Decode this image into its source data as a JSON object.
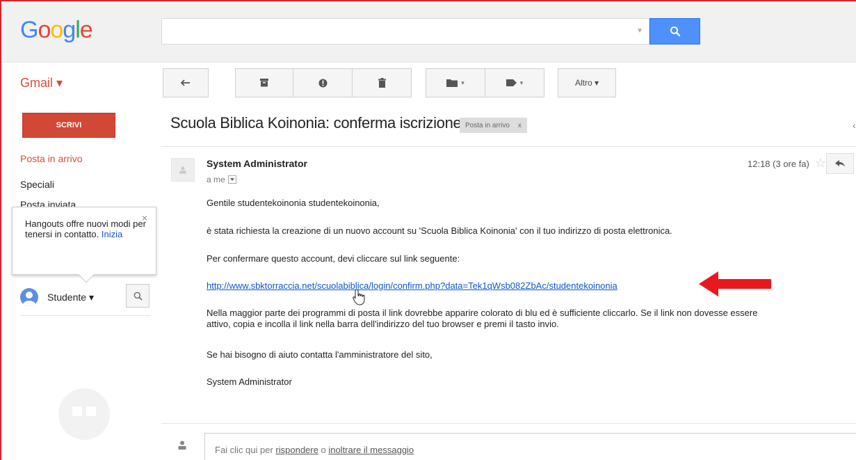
{
  "header": {
    "logo_letters": [
      {
        "ch": "G",
        "color": "#4285f4"
      },
      {
        "ch": "o",
        "color": "#ea4335"
      },
      {
        "ch": "o",
        "color": "#fbbc05"
      },
      {
        "ch": "g",
        "color": "#4285f4"
      },
      {
        "ch": "l",
        "color": "#34a853"
      },
      {
        "ch": "e",
        "color": "#ea4335"
      }
    ],
    "search_value": "",
    "search_dropdown": "▼"
  },
  "toolbar": {
    "app_label": "Gmail ▾",
    "more_label": "Altro ▾",
    "dropdown_caret": "▾"
  },
  "sidebar": {
    "compose_label": "SCRIVI",
    "items": [
      {
        "label": "Posta in arrivo"
      },
      {
        "label": "Speciali"
      },
      {
        "label": "Posta inviata"
      }
    ]
  },
  "hangouts_popup": {
    "text": "Hangouts offre nuovi modi per tenersi in contatto.",
    "link": "Inizia",
    "close": "×"
  },
  "user": {
    "name": "Studente ▾"
  },
  "thread": {
    "subject": "Scuola Biblica Koinonia: conferma iscrizione",
    "label": "Posta in arrivo",
    "label_close": "x",
    "edge_mark": "‹"
  },
  "message": {
    "sender": "System Administrator",
    "to": "a me",
    "time": "12:18 (3 ore fa)",
    "star": "☆",
    "greeting": "Gentile studentekoinonia studentekoinonia,",
    "para1": "è stata richiesta la creazione di un nuovo account su 'Scuola Biblica Koinonia' con il tuo indirizzo di posta elettronica.",
    "para2": "Per confermare questo account, devi cliccare sul link seguente:",
    "link": "http://www.sbktorraccia.net/scuolabiblica/login/confirm.php?data=Tek1qWsb082ZbAc/studentekoinonia",
    "para3_line1": "Nella maggior parte dei programmi di posta il link dovrebbe apparire colorato di blu ed è sufficiente cliccarlo. Se il link non dovesse essere",
    "para3_line2": "attivo, copia e incolla il link nella barra dell'indirizzo del tuo browser e premi il tasto invio.",
    "para4": "Se hai bisogno di aiuto contatta l'amministratore del sito,",
    "signature": "System Administrator"
  },
  "reply": {
    "prefix": "Fai clic qui per ",
    "reply_word": "rispondere",
    "middle": " o ",
    "forward_word": "inoltrare il messaggio"
  },
  "colors": {
    "accent_red": "#dd4b39",
    "compose_red": "#d14836",
    "search_blue": "#4d90fe",
    "link_blue": "#15c",
    "annotation_arrow": "#e8191e"
  }
}
